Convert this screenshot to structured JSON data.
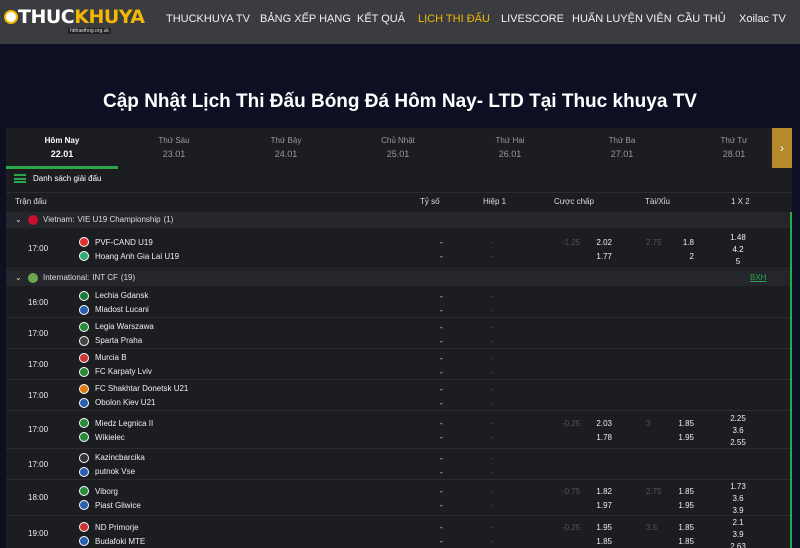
{
  "nav": {
    "logo_part1": "THUC",
    "logo_part2": "KHUYA",
    "logo_sub": "hbhaethog.org.uk",
    "links": [
      "THUCKHUYA TV",
      "BẢNG XẾP HẠNG",
      "KẾT QUẢ",
      "LỊCH THI ĐẤU",
      "LIVESCORE",
      "HUẤN LUYỆN VIÊN",
      "CẦU THỦ",
      "Xoilac TV"
    ],
    "active_index": 3
  },
  "page_title": "Cập Nhật Lịch Thi Đấu Bóng Đá Hôm Nay- LTD Tại Thuc khuya TV",
  "days": [
    {
      "label": "Hôm Nay",
      "date": "22.01"
    },
    {
      "label": "Thứ Sáu",
      "date": "23.01"
    },
    {
      "label": "Thứ Bảy",
      "date": "24.01"
    },
    {
      "label": "Chủ Nhật",
      "date": "25.01"
    },
    {
      "label": "Thứ Hai",
      "date": "26.01"
    },
    {
      "label": "Thứ Ba",
      "date": "27.01"
    },
    {
      "label": "Thứ Tư",
      "date": "28.01"
    }
  ],
  "next_arrow": "›",
  "league_list_label": "Danh sách giải đấu",
  "columns": {
    "match": "Trận đấu",
    "score": "Tỷ số",
    "half1": "Hiệp 1",
    "handicap": "Cược chấp",
    "overunder": "Tài/Xỉu",
    "x12": "1 X 2"
  },
  "leagues": [
    {
      "country": "Vietnam:",
      "name": "VIE U19 Championship",
      "count": "(1)",
      "flag_color": "#c8102e",
      "bxh": "",
      "matches": [
        {
          "time": "17:00",
          "home": "PVF-CAND U19",
          "away": "Hoang Anh Gia Lai U19",
          "home_color": "#d33",
          "away_color": "#3a7",
          "hc_line": "-1.25",
          "hc1": "2.02",
          "hc2": "1.77",
          "ou_line": "2.75",
          "ou1": "1.8",
          "ou2": "2",
          "x1": "1.48",
          "xx": "4.2",
          "x2": "5"
        }
      ]
    },
    {
      "country": "International:",
      "name": "INT CF",
      "count": "(19)",
      "flag_color": "#6aa84f",
      "bxh": "BXH",
      "matches": [
        {
          "time": "16:00",
          "home": "Lechia Gdansk",
          "away": "Mladost Lucani",
          "home_color": "#1a7a3a",
          "away_color": "#2b5fb0"
        },
        {
          "time": "17:00",
          "home": "Legia Warszawa",
          "away": "Sparta Praha",
          "home_color": "#2a8a3a",
          "away_color": "#444"
        },
        {
          "time": "17:00",
          "home": "Murcia B",
          "away": "FC Karpaty Lviv",
          "home_color": "#c33",
          "away_color": "#2a8a3a"
        },
        {
          "time": "17:00",
          "home": "FC Shakhtar Donetsk U21",
          "away": "Obolon Kiev U21",
          "home_color": "#e07a10",
          "away_color": "#2b5fb0"
        },
        {
          "time": "17:00",
          "home": "Miedz Legnica II",
          "away": "Wikielec",
          "home_color": "#2a8a3a",
          "away_color": "#2a8a3a",
          "hc_line": "-0.25",
          "hc1": "2.03",
          "hc2": "1.78",
          "ou_line": "3",
          "ou1": "1.85",
          "ou2": "1.95",
          "x1": "2.25",
          "xx": "3.6",
          "x2": "2.55"
        },
        {
          "time": "17:00",
          "home": "Kazincbarcika",
          "away": "putnok Vse",
          "home_color": "#333",
          "away_color": "#2b5fb0"
        },
        {
          "time": "18:00",
          "home": "Viborg",
          "away": "Piast Gliwice",
          "home_color": "#2a8a3a",
          "away_color": "#2b5fb0",
          "hc_line": "-0.75",
          "hc1": "1.82",
          "hc2": "1.97",
          "ou_line": "2.75",
          "ou1": "1.85",
          "ou2": "1.95",
          "x1": "1.73",
          "xx": "3.6",
          "x2": "3.9"
        },
        {
          "time": "19:00",
          "home": "ND Primorje",
          "away": "Budafoki MTE",
          "home_color": "#c33",
          "away_color": "#2b5fb0",
          "hc_line": "-0.25",
          "hc1": "1.95",
          "hc2": "1.85",
          "ou_line": "3.5",
          "ou1": "1.85",
          "ou2": "1.85",
          "x1": "2.1",
          "xx": "3.9",
          "x2": "2.63"
        }
      ]
    }
  ],
  "dash": "-"
}
